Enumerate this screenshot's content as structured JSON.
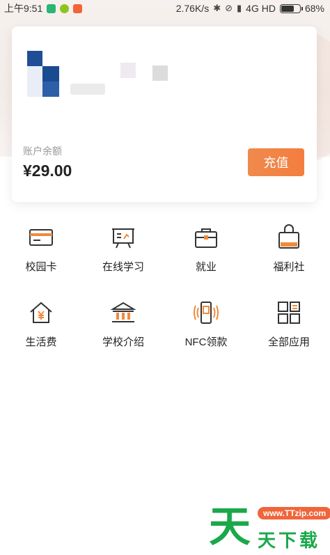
{
  "status_bar": {
    "time": "上午9:51",
    "speed": "2.76K/s",
    "network": "4G HD",
    "battery_percent": "68%",
    "battery_level": 0.68,
    "icons": [
      "shield-icon",
      "wechat-icon",
      "app-notification-icon",
      "bluetooth-icon",
      "vibrate-icon",
      "signal-icon",
      "battery-icon"
    ]
  },
  "account": {
    "balance_label": "账户余额",
    "balance_value": "¥29.00",
    "recharge_label": "充值"
  },
  "apps": [
    {
      "label": "校园卡",
      "icon": "card-icon"
    },
    {
      "label": "在线学习",
      "icon": "presentation-board-icon"
    },
    {
      "label": "就业",
      "icon": "briefcase-icon"
    },
    {
      "label": "福利社",
      "icon": "shopping-bag-icon"
    },
    {
      "label": "生活费",
      "icon": "house-yen-icon"
    },
    {
      "label": "学校介绍",
      "icon": "school-building-icon"
    },
    {
      "label": "NFC领款",
      "icon": "nfc-phone-icon"
    },
    {
      "label": "全部应用",
      "icon": "grid-apps-icon"
    }
  ],
  "watermark": {
    "url": "www.TTzip.com",
    "big_char": "天",
    "text": "天下载"
  },
  "colors": {
    "accent": "#f47d3f",
    "icon_dark": "#333333",
    "icon_orange": "#f08a3c"
  }
}
